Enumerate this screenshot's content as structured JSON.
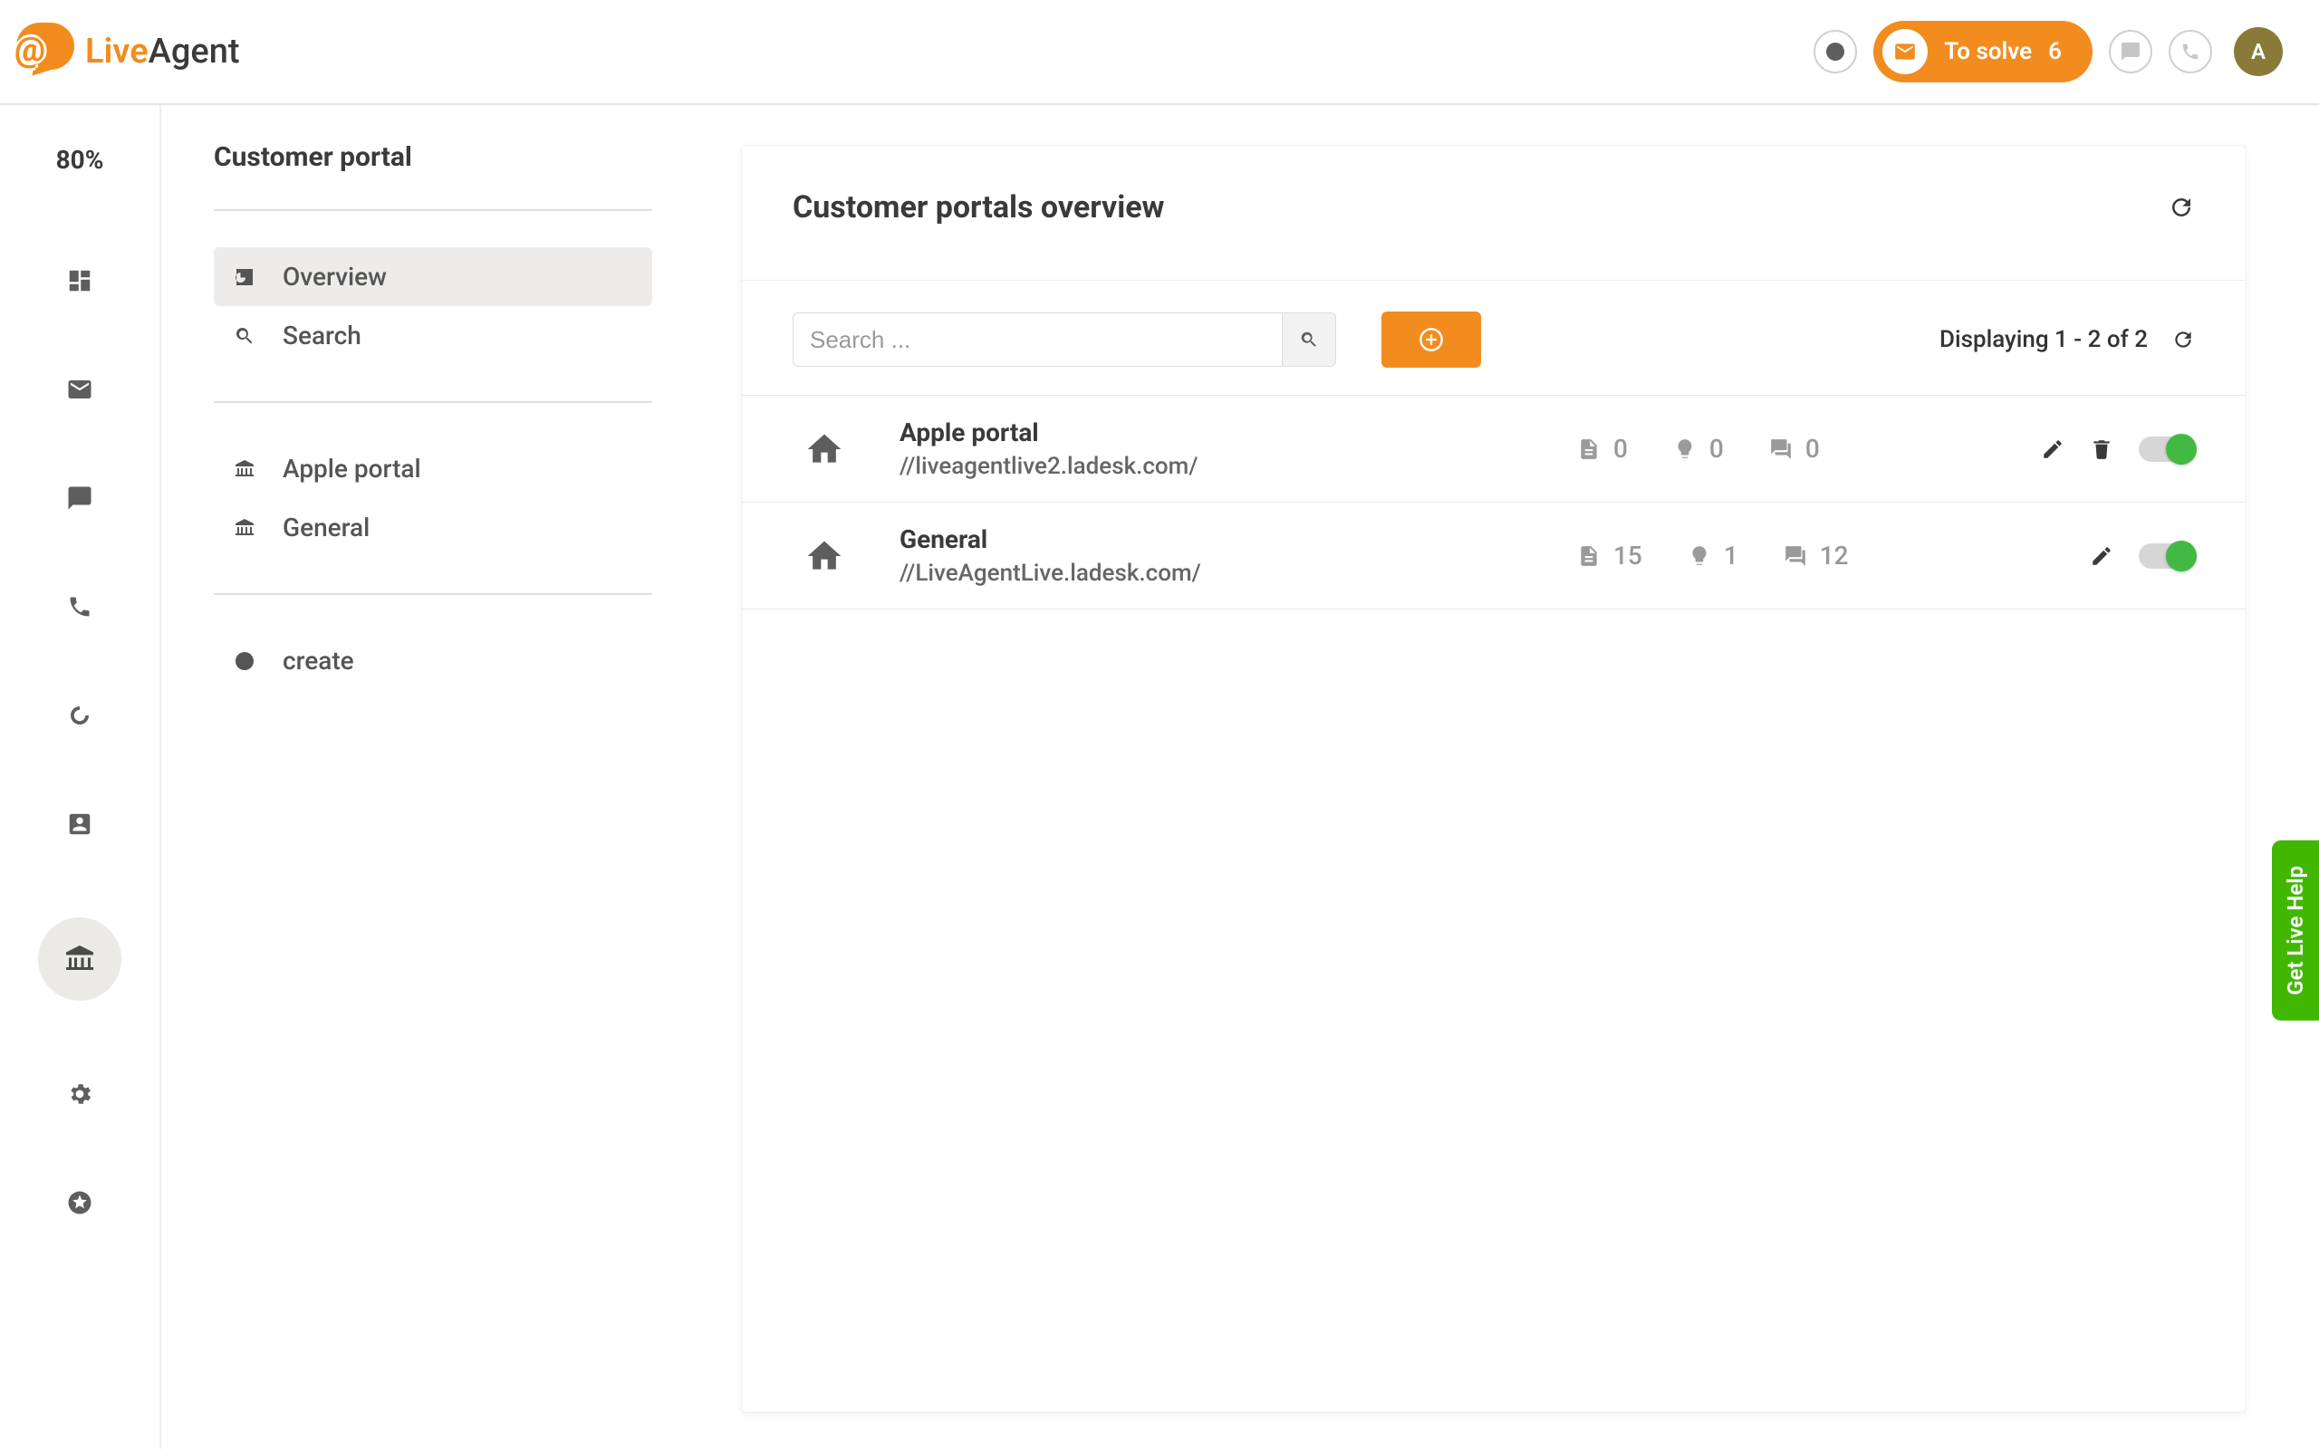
{
  "brand": {
    "name_part1": "Live",
    "name_part2": "Agent"
  },
  "header": {
    "to_solve_label": "To solve",
    "to_solve_count": "6",
    "avatar_initial": "A"
  },
  "rail": {
    "percent": "80%"
  },
  "sidebar": {
    "title": "Customer portal",
    "items": {
      "overview": "Overview",
      "search": "Search"
    },
    "portals": [
      {
        "label": "Apple portal"
      },
      {
        "label": "General"
      }
    ],
    "create_label": "create"
  },
  "main": {
    "title": "Customer portals overview",
    "search_placeholder": "Search ...",
    "display_text": "Displaying 1 - 2 of 2",
    "rows": [
      {
        "name": "Apple portal",
        "url": "//liveagentlive2.ladesk.com/",
        "articles": "0",
        "ideas": "0",
        "forums": "0",
        "deletable": true
      },
      {
        "name": "General",
        "url": "//LiveAgentLive.ladesk.com/",
        "articles": "15",
        "ideas": "1",
        "forums": "12",
        "deletable": false
      }
    ]
  },
  "live_help": "Get Live Help"
}
